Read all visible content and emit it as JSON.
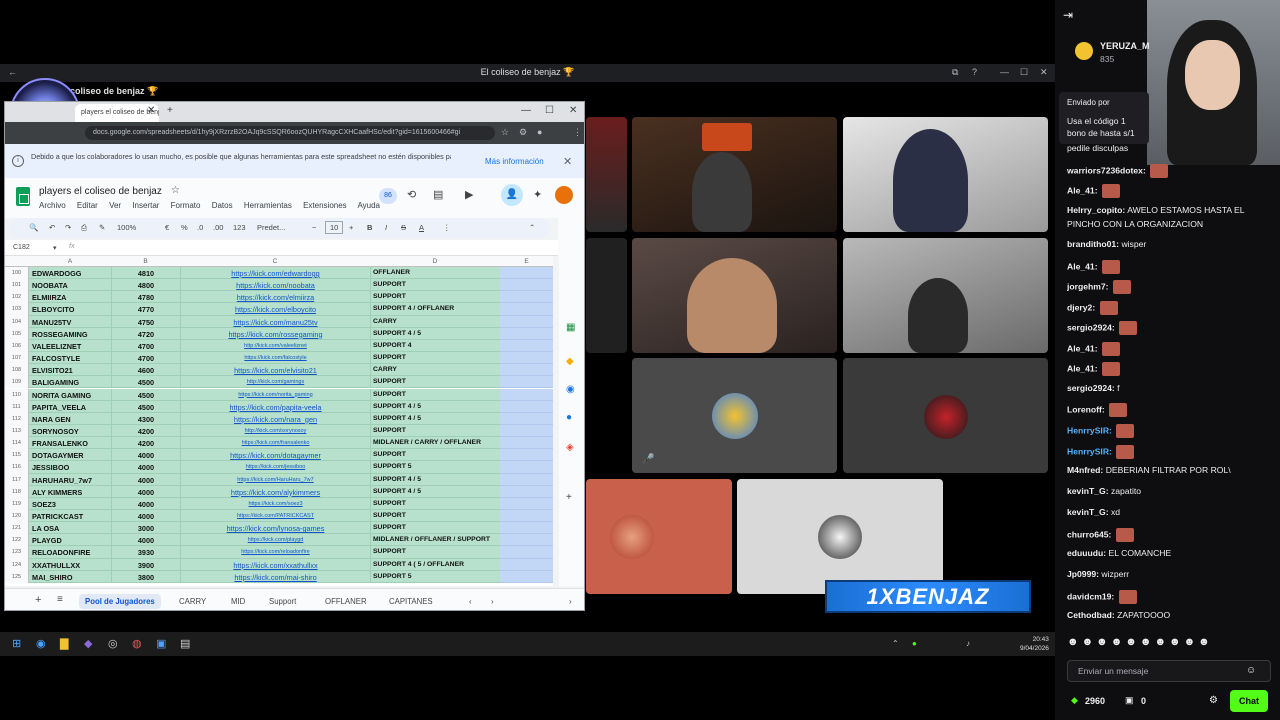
{
  "discord": {
    "window_title": "El coliseo de benjaz 🏆",
    "channel_title": "el coliseo de benjaz 🏆"
  },
  "chrome": {
    "tab_title": "players el coliseo de benjaz - Hoja...",
    "url": "docs.google.com/spreadsheets/d/1hy9jXRzrzB2OAJq9cSSQR6oozQUHYRagcCXHCaafHSc/edit?gid=1615600466#gi",
    "notice_text": "Debido a que los colaboradores lo usan mucho, es posible que algunas herramientas para este spreadsheet no estén disponibles para un público tan amplio. Si deseas hacer ediciones, pídele al propietario que reduzca el número de colaboradores o podrían acceder a él.",
    "notice_more": "Más información"
  },
  "sheets": {
    "doc_title": "players el coliseo de benjaz",
    "menus": [
      "Archivo",
      "Editar",
      "Ver",
      "Insertar",
      "Formato",
      "Datos",
      "Herramientas",
      "Extensiones",
      "Ayuda"
    ],
    "toolbar": {
      "zoom": "100%",
      "currency": "€",
      "percent": "%",
      "dec_less": ".0",
      "dec_more": ".00",
      "format123": "123",
      "font": "Predet...",
      "font_size": "10",
      "bold": "B",
      "italic": "I",
      "strike": "S",
      "text_color": "A"
    },
    "cell_ref": "C182",
    "fx": "fx",
    "viewers": "86",
    "columns": [
      "A",
      "B",
      "C",
      "D",
      "E"
    ],
    "rows": [
      {
        "n": "100",
        "name": "EDWARDOGG",
        "pts": "4810",
        "link": "https://kick.com/edwardogg",
        "role": "OFFLANER",
        "small": false
      },
      {
        "n": "101",
        "name": "NOOBATA",
        "pts": "4800",
        "link": "https://kick.com/noobata",
        "role": "SUPPORT",
        "small": false
      },
      {
        "n": "102",
        "name": "ELMIIRZA",
        "pts": "4780",
        "link": "https://kick.com/elmiirza",
        "role": "SUPPORT",
        "small": false
      },
      {
        "n": "103",
        "name": "ELBOYCITO",
        "pts": "4770",
        "link": "https://kick.com/elboycito",
        "role": "SUPPORT 4 / OFFLANER",
        "small": false
      },
      {
        "n": "104",
        "name": "MANU25TV",
        "pts": "4750",
        "link": "https://kick.com/manu25tv",
        "role": "CARRY",
        "small": false
      },
      {
        "n": "105",
        "name": "ROSSEGAMING",
        "pts": "4720",
        "link": "https://kick.com/rossegaming",
        "role": "SUPPORT 4 / 5",
        "small": false
      },
      {
        "n": "106",
        "name": "VALEELIZNET",
        "pts": "4700",
        "link": "http://kick.com/valeeliznet",
        "role": "SUPPORT 4",
        "small": true
      },
      {
        "n": "107",
        "name": "FALCOSTYLE",
        "pts": "4700",
        "link": "https://kick.com/falcostyle",
        "role": "SUPPORT",
        "small": true
      },
      {
        "n": "108",
        "name": "ELVISITO21",
        "pts": "4600",
        "link": "https://kick.com/elvisito21",
        "role": "CARRY",
        "small": false
      },
      {
        "n": "109",
        "name": "BALIGAMING",
        "pts": "4500",
        "link": "http://kick.com/gamings",
        "role": "SUPPORT",
        "small": true
      },
      {
        "n": "110",
        "name": "NORITA GAMING",
        "pts": "4500",
        "link": "https://kick.com/norita_gaming",
        "role": "SUPPORT",
        "small": true
      },
      {
        "n": "111",
        "name": "PAPITA_VEELA",
        "pts": "4500",
        "link": "https://kick.com/papita-veela",
        "role": "SUPPORT 4 / 5",
        "small": false
      },
      {
        "n": "112",
        "name": "NARA GEN",
        "pts": "4300",
        "link": "https://kick.com/nara_gen",
        "role": "SUPPORT 4 / 5",
        "small": false
      },
      {
        "n": "113",
        "name": "SORYNOSOY",
        "pts": "4200",
        "link": "http://kick.com/sorynosoy",
        "role": "SUPPORT",
        "small": true
      },
      {
        "n": "114",
        "name": "FRANSALENKO",
        "pts": "4200",
        "link": "https://kick.com/fransalenko",
        "role": "MIDLANER / CARRY / OFFLANER",
        "small": true
      },
      {
        "n": "115",
        "name": "DOTAGAYMER",
        "pts": "4000",
        "link": "https://kick.com/dotagaymer",
        "role": "SUPPORT",
        "small": false
      },
      {
        "n": "116",
        "name": "JESSIBOO",
        "pts": "4000",
        "link": "https://kick.com/jessiboo",
        "role": "SUPPORT 5",
        "small": true
      },
      {
        "n": "117",
        "name": "HARUHARU_7w7",
        "pts": "4000",
        "link": "https://kick.com/HaruHaru_7w7",
        "role": "SUPPORT 4 / 5",
        "small": true
      },
      {
        "n": "118",
        "name": "ALY KIMMERS",
        "pts": "4000",
        "link": "https://kick.com/alykimmers",
        "role": "SUPPORT 4 / 5",
        "small": false
      },
      {
        "n": "119",
        "name": "SOEZ3",
        "pts": "4000",
        "link": "https://kick.com/soez3",
        "role": "SUPPORT",
        "small": true
      },
      {
        "n": "120",
        "name": "PATRICKCAST",
        "pts": "4000",
        "link": "https://kick.com/PATRICKCAST",
        "role": "SUPPORT",
        "small": true
      },
      {
        "n": "121",
        "name": "LA OSA",
        "pts": "3000",
        "link": "https://kick.com/lynosa-games",
        "role": "SUPPORT",
        "small": false
      },
      {
        "n": "122",
        "name": "PLAYGD",
        "pts": "4000",
        "link": "https://kick.com/playgd",
        "role": "MIDLANER / OFFLANER / SUPPORT",
        "small": true
      },
      {
        "n": "123",
        "name": "RELOADONFIRE",
        "pts": "3930",
        "link": "https://kick.com/reloadonfire",
        "role": "SUPPORT",
        "small": true
      },
      {
        "n": "124",
        "name": "XXATHULLXX",
        "pts": "3900",
        "link": "https://kick.com/xxathullxx",
        "role": "SUPPORT 4 ( 5 / OFFLANER",
        "small": false
      },
      {
        "n": "125",
        "name": "MAI_SHIRO",
        "pts": "3800",
        "link": "https://kick.com/mai-shiro",
        "role": "SUPPORT 5",
        "small": false
      }
    ],
    "sheet_tabs": [
      "Pool de Jugadores",
      "CARRY",
      "MID",
      "Support",
      "OFFLANER",
      "CAPITANES"
    ]
  },
  "taskbar": {
    "time": "20:43",
    "date": "9/04/2026"
  },
  "stream": {
    "banner": "1XBENJAZ"
  },
  "chat": {
    "top_user": "YERUZA_M",
    "top_points": "835",
    "sent_by": "Enviado por",
    "promo_1": "Usa el código 1",
    "promo_2": "bono de hasta s/1",
    "messages": [
      {
        "user": "",
        "text": "pedile disculpas",
        "color": "#efeff1"
      },
      {
        "user": "warriors7236dotex:",
        "text": "",
        "emote": true,
        "color": "#efeff1"
      },
      {
        "user": "Ale_41:",
        "text": "",
        "emote": true,
        "color": "#efeff1"
      },
      {
        "user": "Helrry_copito:",
        "text": "AWELO ESTAMOS HASTA EL",
        "color": "#efeff1"
      },
      {
        "user": "",
        "text": "PINCHO CON LA ORGANIZACION",
        "color": "#efeff1"
      },
      {
        "user": "branditho01:",
        "text": "wisper",
        "color": "#efeff1"
      },
      {
        "user": "Ale_41:",
        "text": "",
        "emote": true,
        "color": "#efeff1"
      },
      {
        "user": "jorgehm7:",
        "text": "",
        "emote": true,
        "color": "#efeff1"
      },
      {
        "user": "djery2:",
        "text": "",
        "emote": true,
        "color": "#efeff1"
      },
      {
        "user": "sergio2924:",
        "text": "",
        "emote": true,
        "color": "#efeff1"
      },
      {
        "user": "Ale_41:",
        "text": "",
        "emote": true,
        "color": "#efeff1"
      },
      {
        "user": "Ale_41:",
        "text": "",
        "emote": true,
        "color": "#efeff1"
      },
      {
        "user": "sergio2924:",
        "text": "f",
        "color": "#efeff1"
      },
      {
        "user": "Lorenoff:",
        "text": "",
        "emote": true,
        "color": "#efeff1"
      },
      {
        "user": "HenrrySIR:",
        "text": "",
        "emote": true,
        "color": "#53b3ff"
      },
      {
        "user": "HenrrySIR:",
        "text": "",
        "emote": true,
        "color": "#53b3ff"
      },
      {
        "user": "M4nfred:",
        "text": "DEBERIAN FILTRAR POR ROL\\",
        "color": "#efeff1"
      },
      {
        "user": "kevinT_G:",
        "text": "zapatito",
        "color": "#efeff1"
      },
      {
        "user": "kevinT_G:",
        "text": "xd",
        "color": "#efeff1"
      },
      {
        "user": "churro645:",
        "text": "",
        "emote": true,
        "color": "#efeff1"
      },
      {
        "user": "eduuudu:",
        "text": "EL COMANCHE",
        "color": "#efeff1"
      },
      {
        "user": "Jp0999:",
        "text": "wizperr",
        "color": "#efeff1"
      },
      {
        "user": "davidcm19:",
        "text": "",
        "emote": true,
        "color": "#efeff1"
      },
      {
        "user": "Cethodbad:",
        "text": "ZAPATOOOO",
        "color": "#efeff1"
      }
    ],
    "input_placeholder": "Enviar un mensaje",
    "points": "2960",
    "gifts": "0",
    "send_label": "Chat"
  }
}
